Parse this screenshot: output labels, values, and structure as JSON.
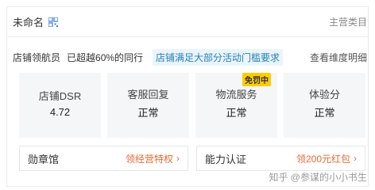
{
  "header": {
    "shop_name": "未命名",
    "main_category_label": "主营类目"
  },
  "level": {
    "title": "店铺领航员",
    "desc": "已超越60%的同行",
    "promo": "店铺满足大部分活动门槛要求",
    "view_link": "查看维度明细"
  },
  "metrics": [
    {
      "label": "店铺DSR",
      "value": "4.72"
    },
    {
      "label": "客服回复",
      "value": "正常"
    },
    {
      "label": "物流服务",
      "value": "正常",
      "badge": "免罚中"
    },
    {
      "label": "体验分",
      "value": "正常"
    }
  ],
  "bottom": {
    "honor_title": "勋章馆",
    "honor_link": "领经营特权",
    "ability_title": "能力认证",
    "ability_link": "领200元红包"
  },
  "watermark": "知乎 @参谋的小小书生",
  "colors": {
    "promo_bg": "#e9f5fb",
    "promo_text": "#2a7fb6",
    "badge_bg": "#ffcc00",
    "link_orange": "#e86a32",
    "metric_bg": "#f5f6f8"
  }
}
